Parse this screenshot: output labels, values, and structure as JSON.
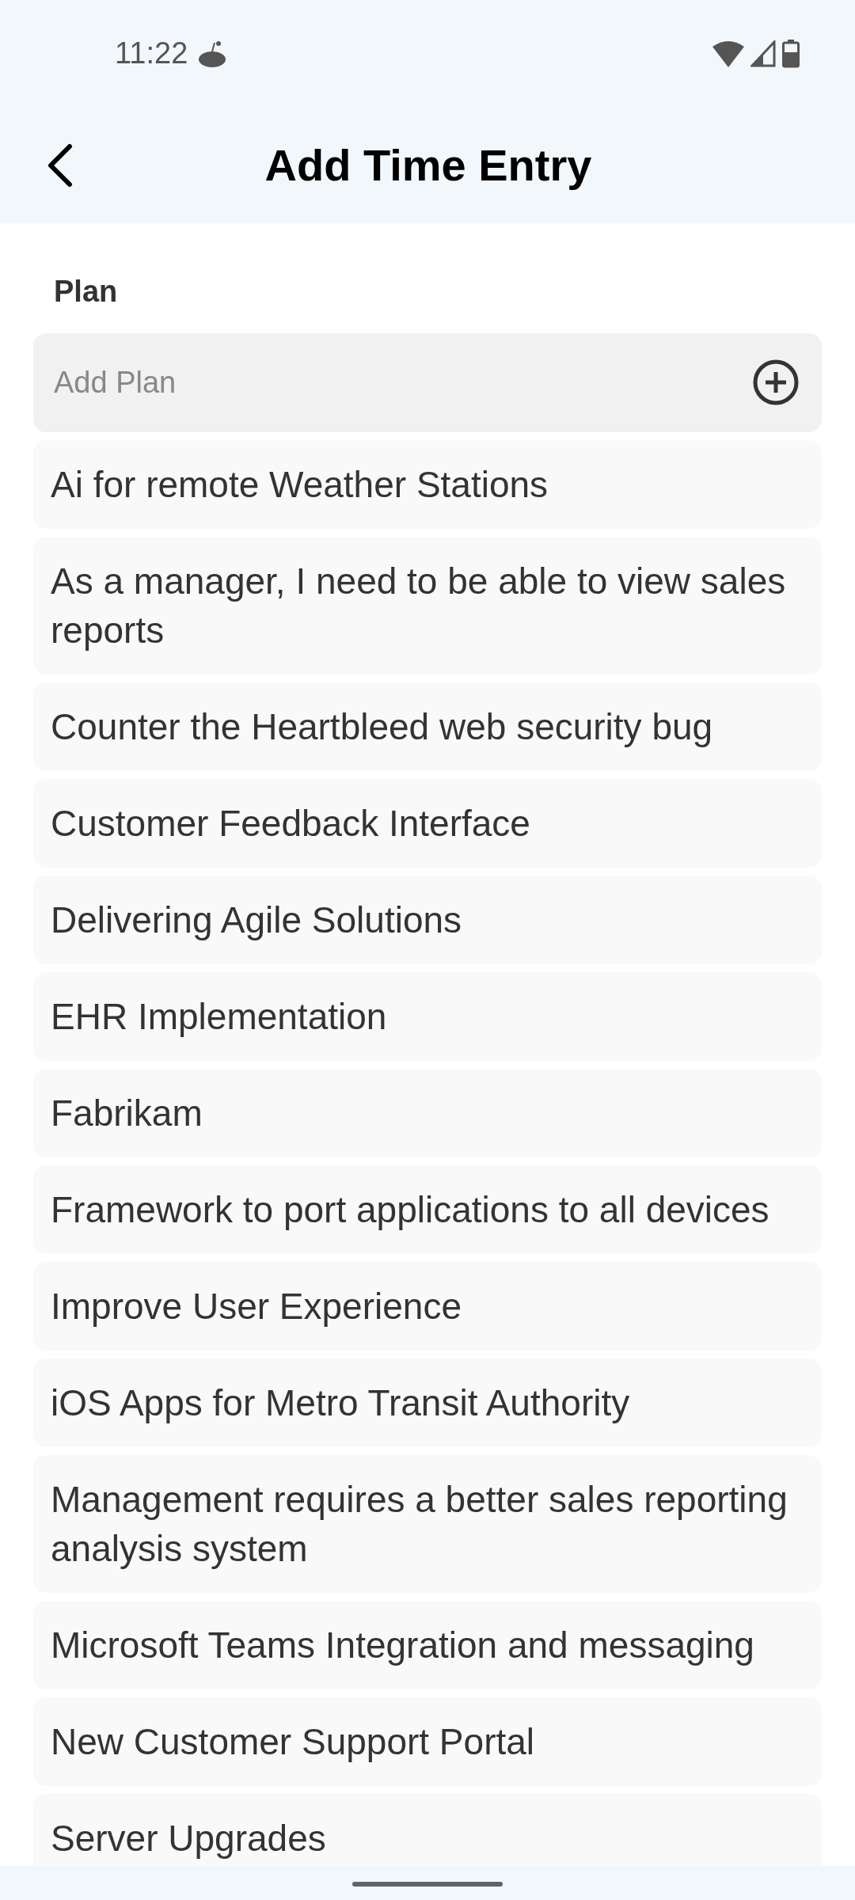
{
  "status_bar": {
    "time": "11:22"
  },
  "header": {
    "title": "Add Time Entry"
  },
  "plan": {
    "label": "Plan",
    "placeholder": "Add Plan",
    "items": [
      "Ai for remote Weather Stations",
      "As a manager, I need to be able to view sales reports",
      "Counter the Heartbleed web security bug",
      "Customer Feedback Interface",
      "Delivering Agile Solutions",
      "EHR Implementation",
      "Fabrikam",
      "Framework to port applications to all devices",
      "Improve User Experience",
      "iOS Apps for Metro Transit Authority",
      "Management requires a better sales reporting analysis system",
      "Microsoft Teams Integration and messaging",
      "New Customer Support Portal",
      "Server Upgrades"
    ]
  }
}
